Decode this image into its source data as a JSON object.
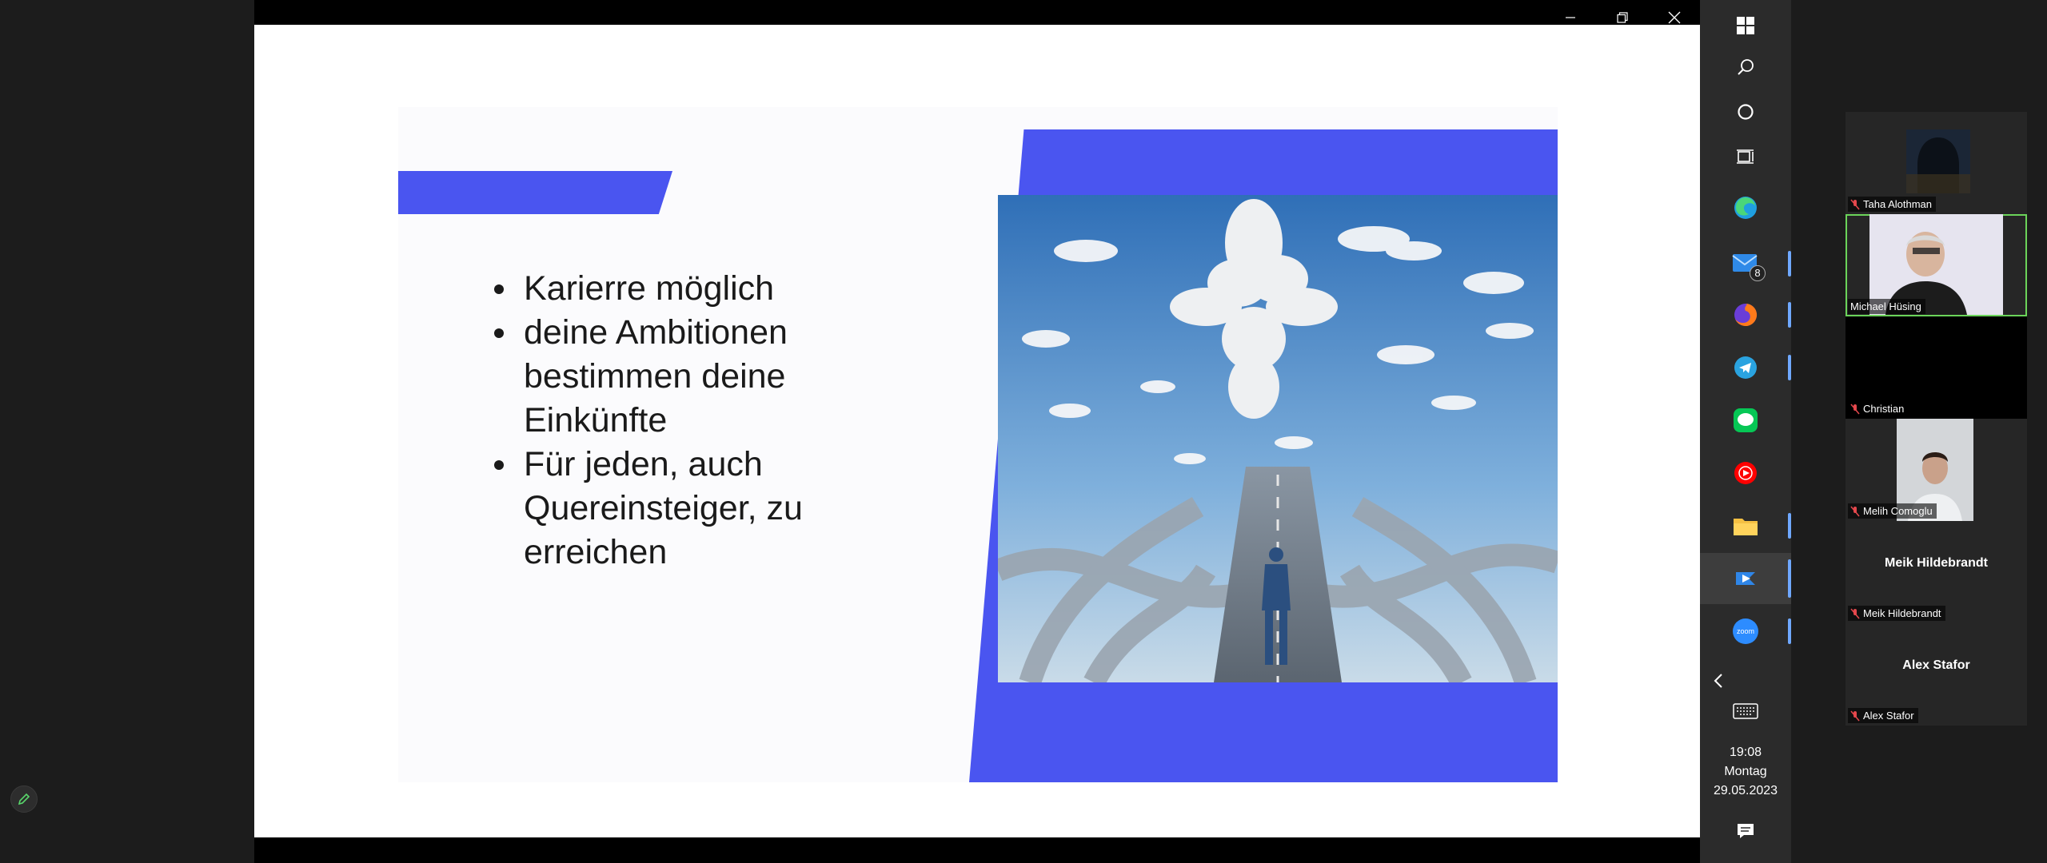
{
  "slide": {
    "bullets": [
      "Karierre möglich",
      "deine Ambitionen bestimmen deine Einkünfte",
      "Für jeden, auch Quereinsteiger, zu erreichen"
    ]
  },
  "taskbar": {
    "mail_badge": "8",
    "zoom_label": "zoom",
    "time": "19:08",
    "day": "Montag",
    "date": "29.05.2023"
  },
  "participants": [
    {
      "name": "Taha Alothman",
      "muted": true,
      "video": true
    },
    {
      "name": "Michael Hüsing",
      "muted": false,
      "video": true,
      "active_speaker": true
    },
    {
      "name": "Christian",
      "muted": true,
      "video": false
    },
    {
      "name": "Melih Comoglu",
      "muted": true,
      "video": true
    },
    {
      "name": "Meik Hildebrandt",
      "display_name": "Meik Hildebrandt",
      "muted": true,
      "video": false
    },
    {
      "name": "Alex Stafor",
      "display_name": "Alex Stafor",
      "muted": true,
      "video": false
    }
  ],
  "colors": {
    "accent": "#4a55f0",
    "active_speaker": "#6bd45a"
  }
}
